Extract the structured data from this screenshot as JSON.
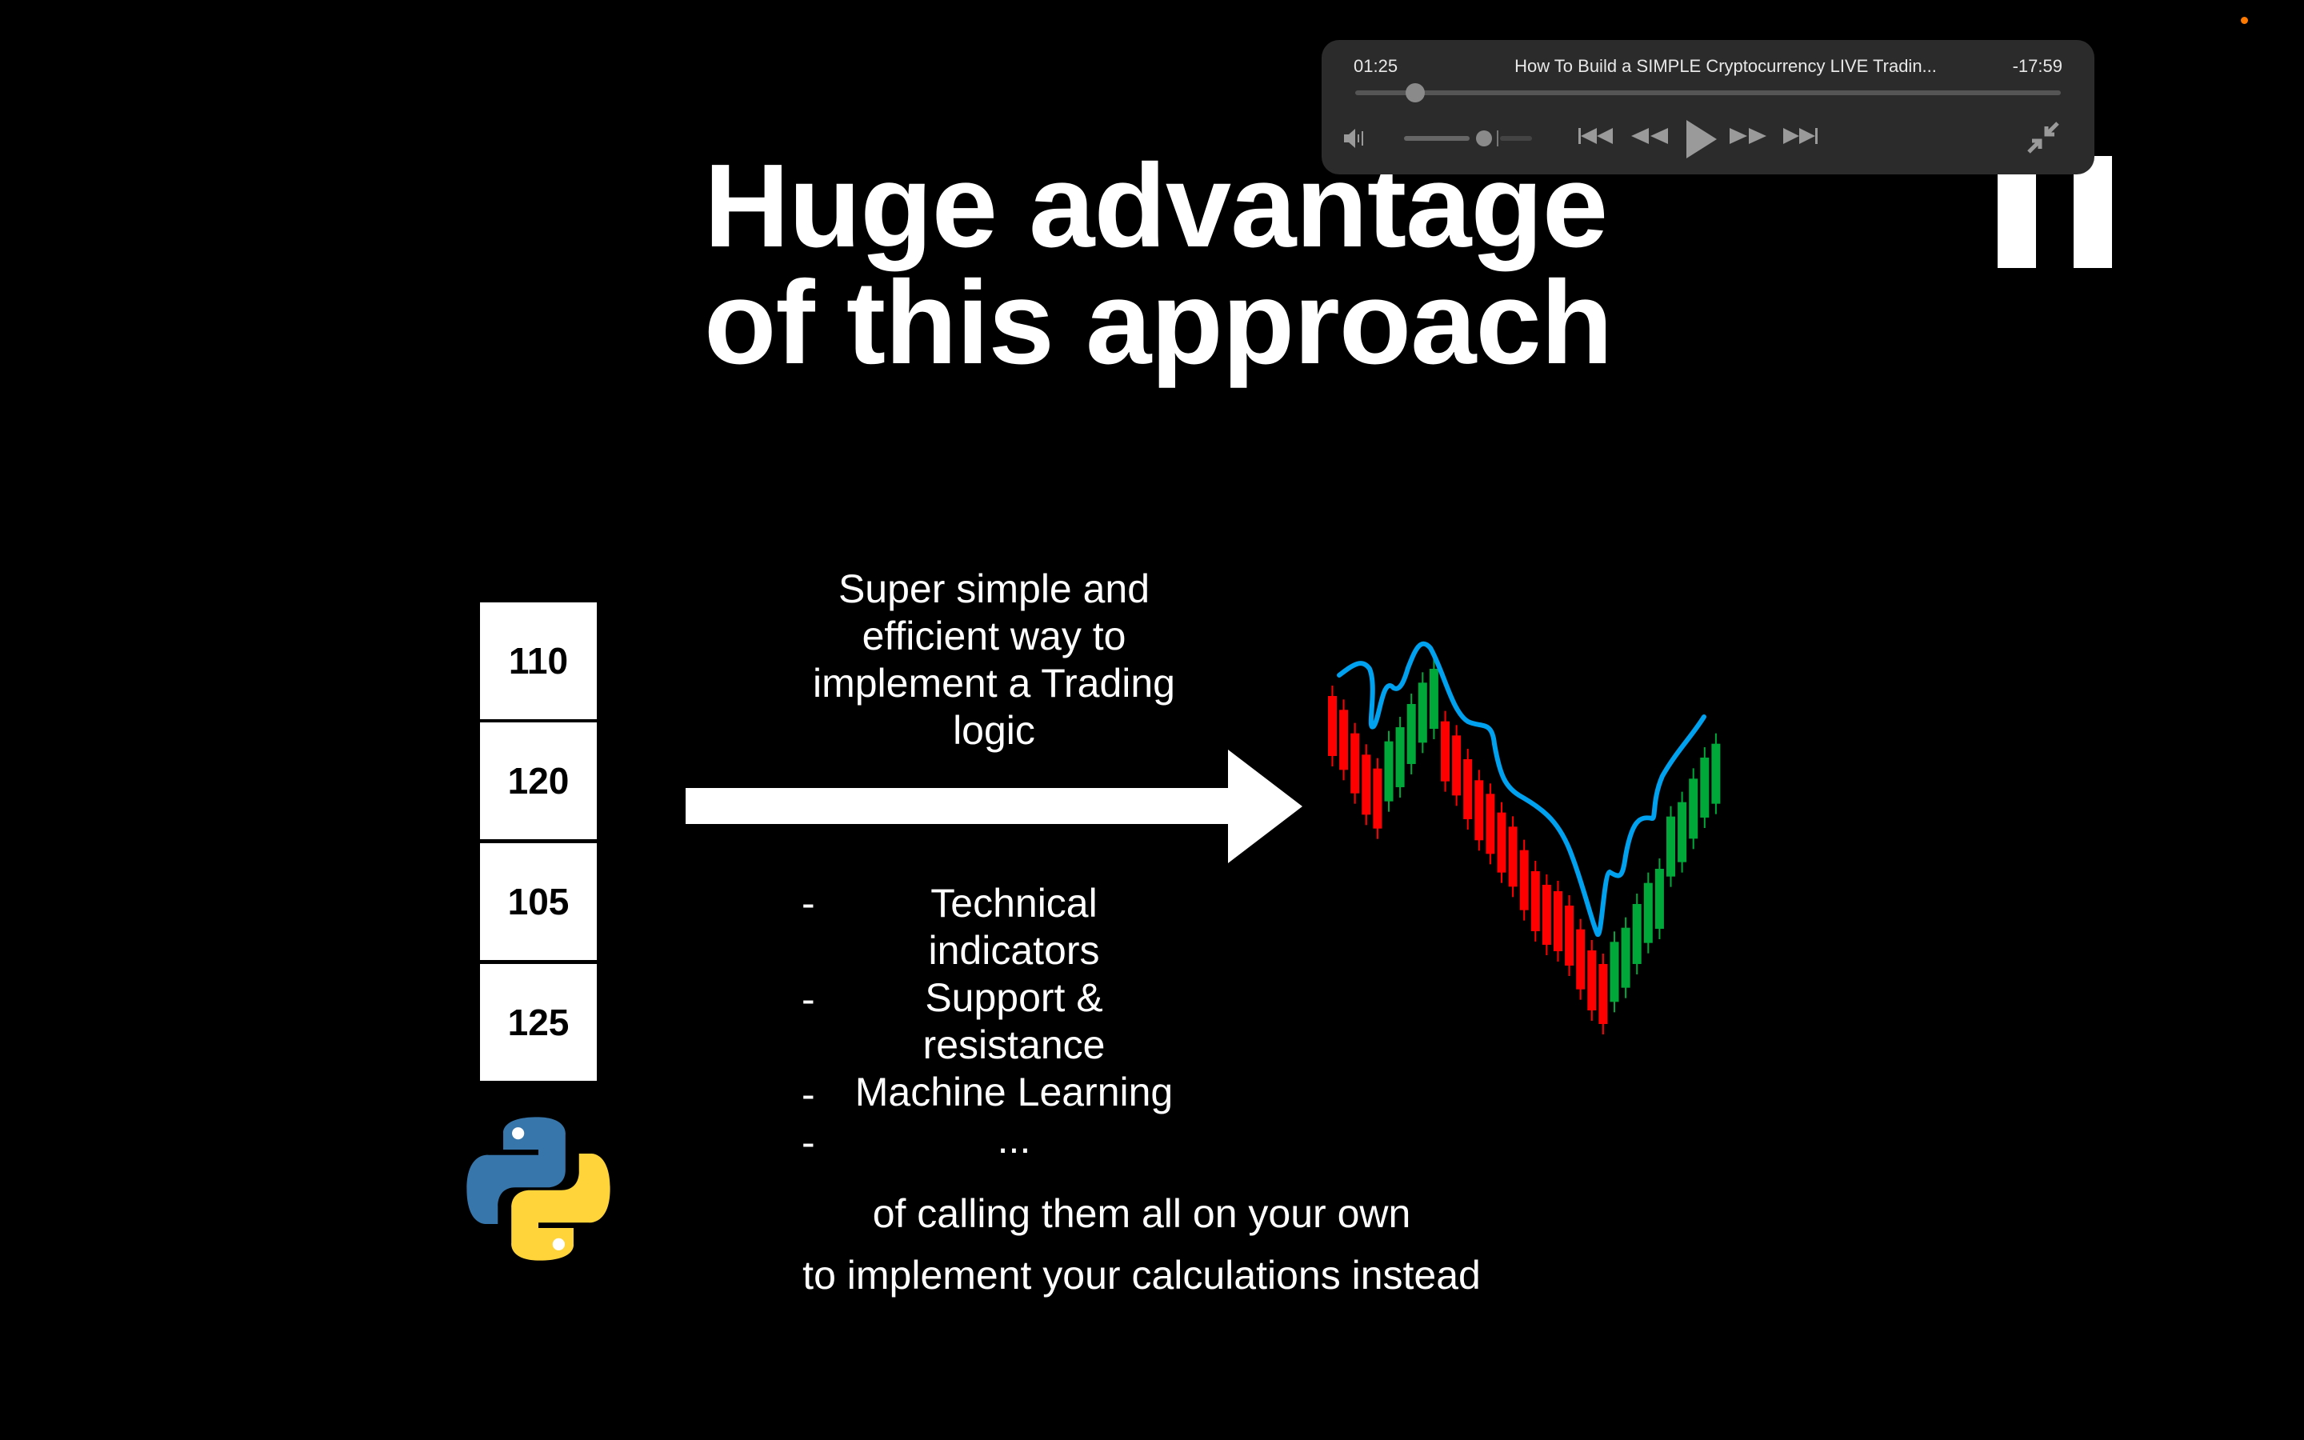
{
  "slide": {
    "title_line1": "Huge advantage",
    "title_line2": "of this approach",
    "data_boxes": [
      "110",
      "120",
      "105",
      "125"
    ],
    "arrow_caption": [
      "Super simple and",
      "efficient way to",
      "implement a Trading",
      "logic"
    ],
    "list_dash": "-",
    "list_lines": [
      "Technical",
      "indicators",
      "Support &",
      "resistance",
      "Machine Learning",
      "..."
    ],
    "bottom_line1": "of calling them all on your own",
    "bottom_line2": "to implement your calculations instead",
    "colors": {
      "bearish": "#ff0000",
      "bullish": "#00a83a",
      "moving_average": "#00a2ef"
    }
  },
  "player": {
    "elapsed": "01:25",
    "title": "How To Build a SIMPLE Cryptocurrency LIVE Tradin...",
    "remaining": "-17:59",
    "progress": 0.03,
    "volume": 0.65
  },
  "recording_indicator_color": "#ff7a00"
}
